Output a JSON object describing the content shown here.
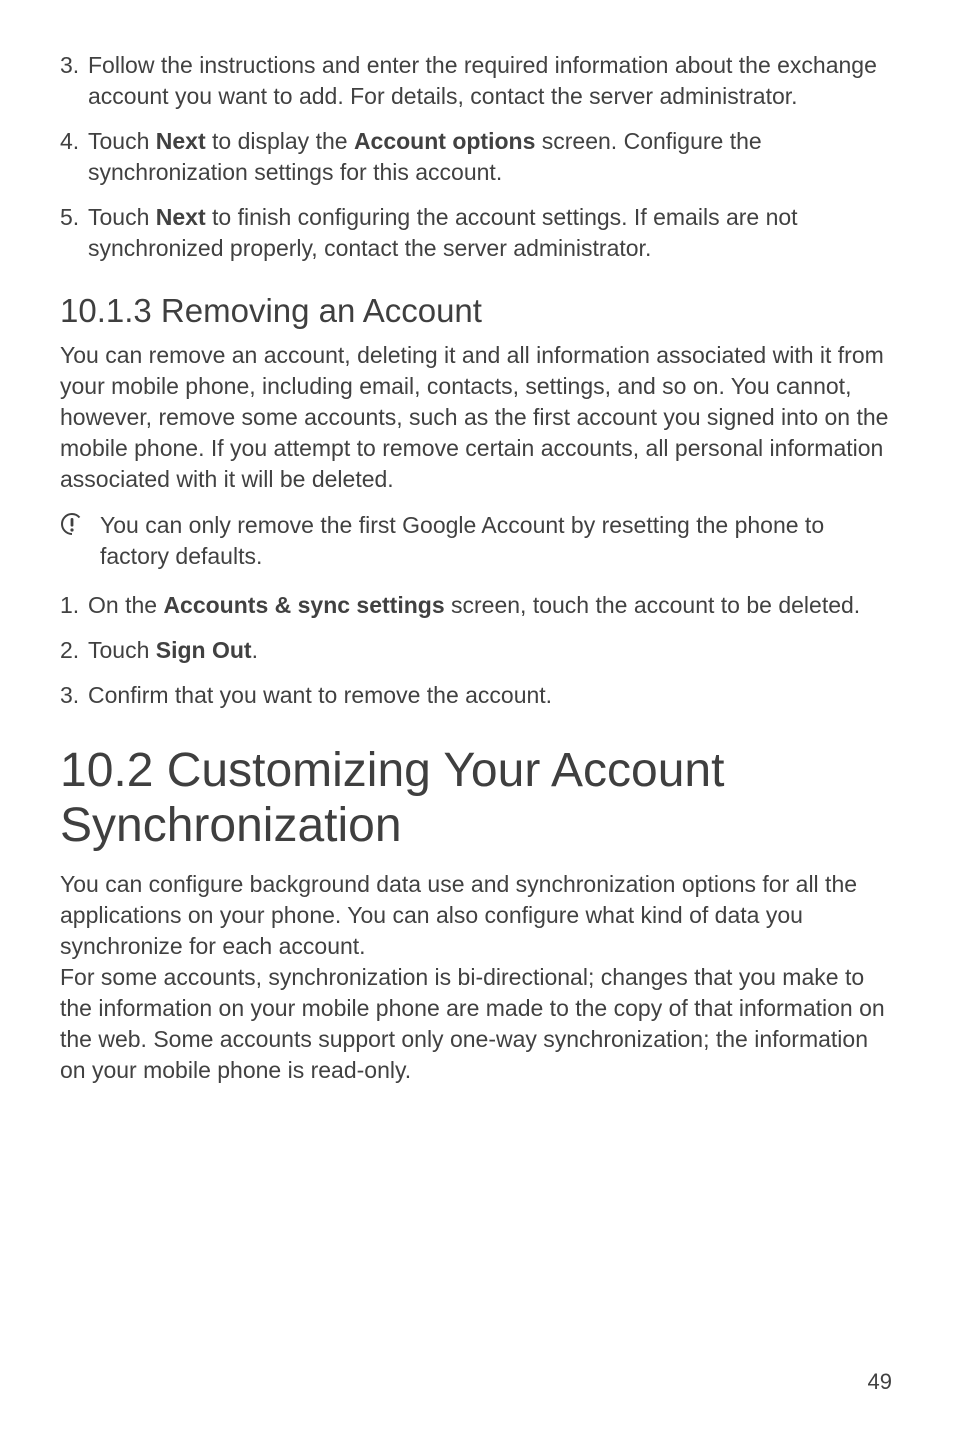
{
  "steps_a": [
    {
      "num": "3.",
      "parts": [
        {
          "t": "Follow the instructions and enter the required information about the exchange account you want to add. For details, contact the server administrator."
        }
      ]
    },
    {
      "num": "4.",
      "parts": [
        {
          "t": "Touch "
        },
        {
          "t": "Next",
          "bold": true
        },
        {
          "t": " to display the "
        },
        {
          "t": "Account options",
          "bold": true
        },
        {
          "t": " screen. Configure the synchronization settings for this account."
        }
      ]
    },
    {
      "num": "5.",
      "parts": [
        {
          "t": "Touch "
        },
        {
          "t": "Next",
          "bold": true
        },
        {
          "t": " to finish configuring the account settings. If emails are not synchronized properly, contact the server administrator."
        }
      ]
    }
  ],
  "subheading_1": "10.1.3  Removing an Account",
  "para_1": "You can remove an account, deleting it and all information associated with it from your mobile phone, including email, contacts, settings, and so on. You cannot, however, remove some accounts, such as the first account you signed into on the mobile phone. If you attempt to remove certain accounts, all personal information associated with it will be deleted.",
  "note_1": "You can only remove the first Google Account by resetting the phone to factory defaults.",
  "steps_b": [
    {
      "num": "1.",
      "parts": [
        {
          "t": "On the "
        },
        {
          "t": "Accounts & sync settings",
          "bold": true
        },
        {
          "t": " screen, touch the account to be deleted."
        }
      ]
    },
    {
      "num": "2.",
      "parts": [
        {
          "t": "Touch "
        },
        {
          "t": "Sign Out",
          "bold": true
        },
        {
          "t": "."
        }
      ]
    },
    {
      "num": "3.",
      "parts": [
        {
          "t": "Confirm that you want to remove the account."
        }
      ]
    }
  ],
  "section_heading": "10.2  Customizing Your Account Synchronization",
  "para_2": "You can configure background data use and synchronization options for all the applications on your phone. You can also configure what kind of data you synchronize for each account.",
  "para_3": "For some accounts, synchronization is bi-directional; changes that you make to the information on your mobile phone are made to the copy of that information on the web. Some accounts support only one-way synchronization; the information on your mobile phone is read-only.",
  "page_number": "49"
}
